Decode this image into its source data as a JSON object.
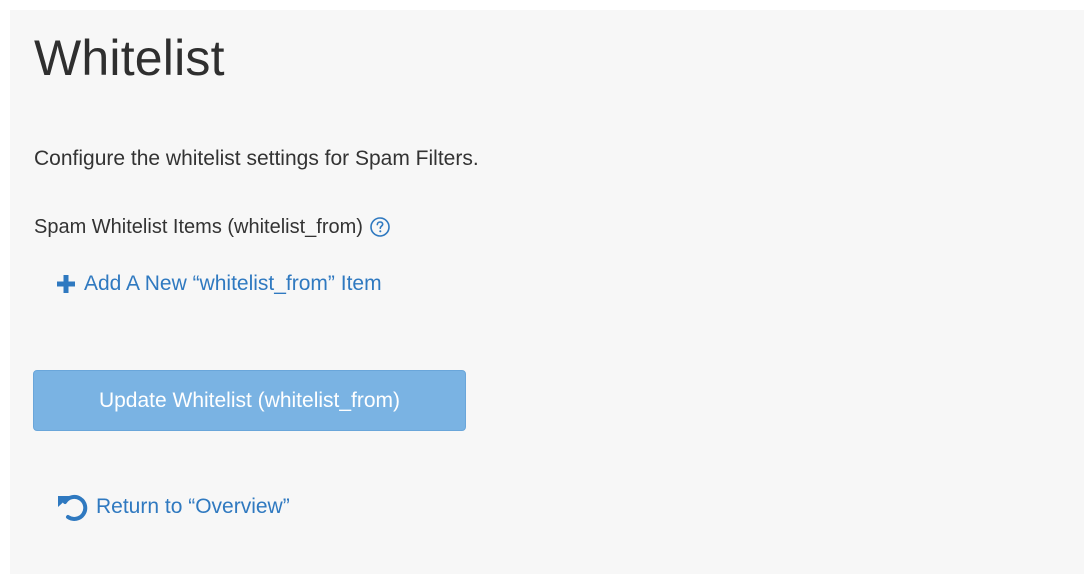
{
  "page": {
    "title": "Whitelist",
    "description": "Configure the whitelist settings for Spam Filters."
  },
  "section": {
    "label": "Spam Whitelist Items (whitelist_from)",
    "help_icon": "question-circle-icon"
  },
  "actions": {
    "add_item_label": "Add A New “whitelist_from” Item",
    "add_item_icon": "plus-icon",
    "update_button_label": "Update Whitelist (whitelist_from)",
    "return_label": "Return to “Overview”",
    "return_icon": "undo-icon"
  },
  "colors": {
    "link": "#2f79c0",
    "button_bg": "#7ab3e3",
    "panel_bg": "#f7f7f7",
    "text": "#333333"
  }
}
